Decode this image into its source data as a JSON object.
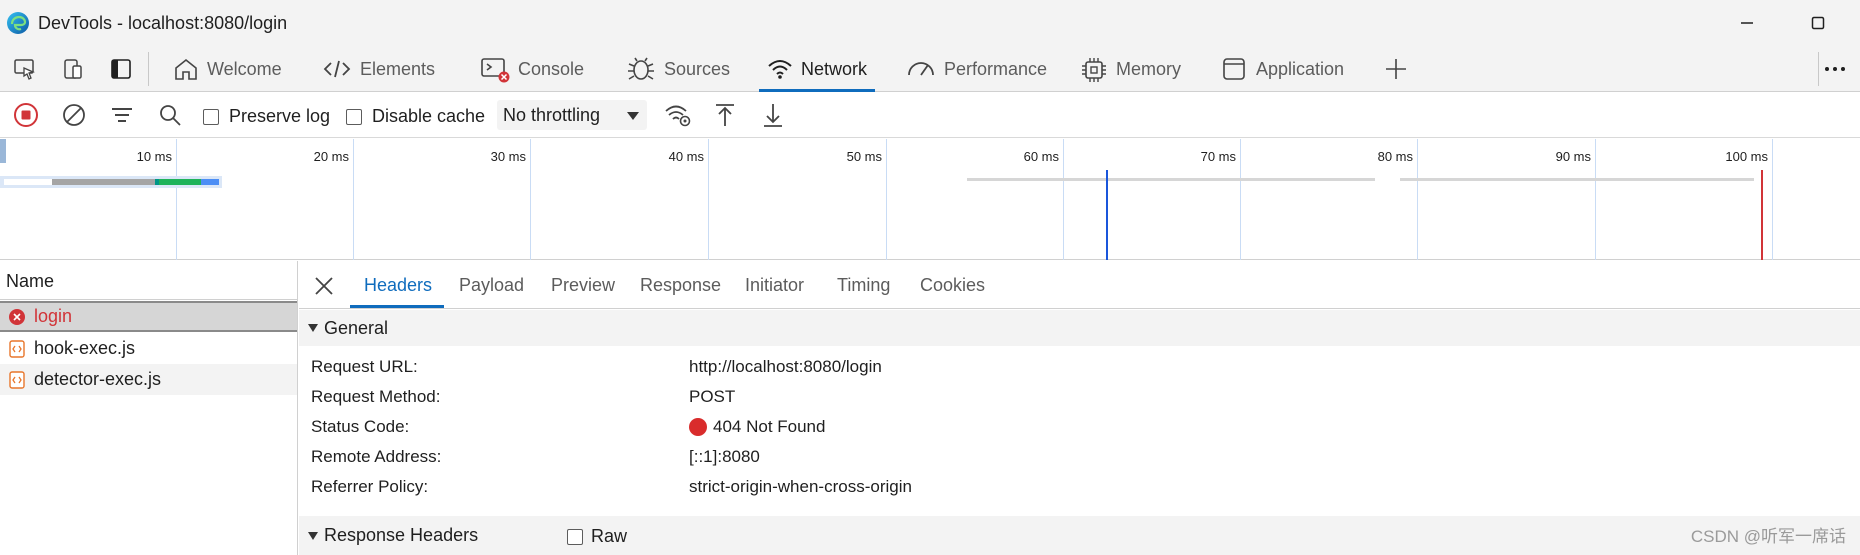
{
  "window": {
    "title": "DevTools - localhost:8080/login"
  },
  "tabs": [
    {
      "label": "Welcome",
      "icon": "home-icon"
    },
    {
      "label": "Elements",
      "icon": "code-icon"
    },
    {
      "label": "Console",
      "icon": "console-icon"
    },
    {
      "label": "Sources",
      "icon": "bug-icon"
    },
    {
      "label": "Network",
      "icon": "wifi-icon",
      "active": true
    },
    {
      "label": "Performance",
      "icon": "gauge-icon"
    },
    {
      "label": "Memory",
      "icon": "chip-icon"
    },
    {
      "label": "Application",
      "icon": "app-window-icon"
    }
  ],
  "toolbar": {
    "preserve_log": "Preserve log",
    "disable_cache": "Disable cache",
    "throttling": "No throttling"
  },
  "overview": {
    "ticks": [
      "10 ms",
      "20 ms",
      "30 ms",
      "40 ms",
      "50 ms",
      "60 ms",
      "70 ms",
      "80 ms",
      "90 ms",
      "100 ms"
    ]
  },
  "requests": {
    "header": "Name",
    "items": [
      {
        "name": "login",
        "status": "error"
      },
      {
        "name": "hook-exec.js",
        "status": "ok"
      },
      {
        "name": "detector-exec.js",
        "status": "ok"
      }
    ]
  },
  "details": {
    "tabs": [
      "Headers",
      "Payload",
      "Preview",
      "Response",
      "Initiator",
      "Timing",
      "Cookies"
    ],
    "general_title": "General",
    "general": [
      {
        "key": "Request URL:",
        "value": "http://localhost:8080/login"
      },
      {
        "key": "Request Method:",
        "value": "POST"
      },
      {
        "key": "Status Code:",
        "value": "404 Not Found"
      },
      {
        "key": "Remote Address:",
        "value": "[::1]:8080"
      },
      {
        "key": "Referrer Policy:",
        "value": "strict-origin-when-cross-origin"
      }
    ],
    "response_headers_title": "Response Headers",
    "raw_label": "Raw"
  },
  "watermark": "CSDN @听军一席话",
  "colors": {
    "accent": "#0f6cbd",
    "error": "#d92c2c",
    "record": "#d13438"
  }
}
